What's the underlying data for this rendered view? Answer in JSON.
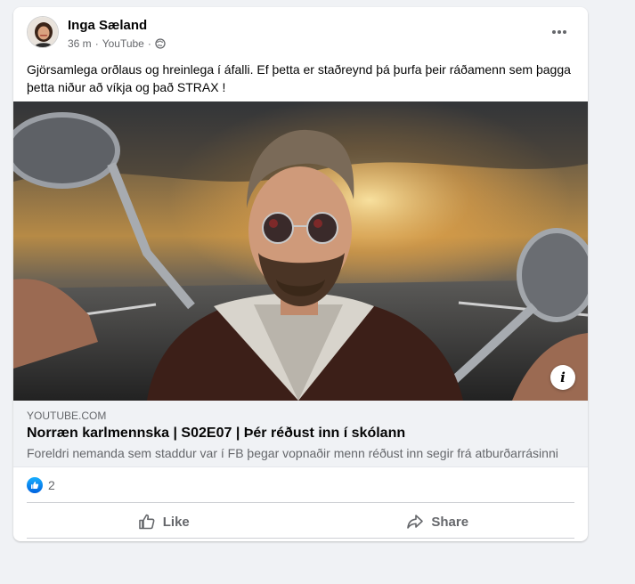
{
  "post": {
    "author": "Inga Sæland",
    "time": "36 m",
    "separator": "·",
    "source": "YouTube",
    "privacy_icon": "globe-icon",
    "more_icon": "more-horizontal-icon",
    "text": "Gjörsamlega orðlaus og hreinlega í áfalli. Ef þetta er staðreynd þá þurfa þeir ráðamenn sem þagga þetta niður að víkja og það STRAX !"
  },
  "link_preview": {
    "domain": "YOUTUBE.COM",
    "title": "Norræn karlmennska | S02E07 | Þér réðust inn í skólann",
    "description": "Foreldri nemanda sem staddur var í FB þegar vopnaðir menn réðust inn segir frá atburðarrásinni",
    "info_label": "i"
  },
  "reactions": {
    "icon": "like-reaction-icon",
    "count": "2"
  },
  "actions": {
    "like_label": "Like",
    "share_label": "Share"
  },
  "colors": {
    "accent_blue": "#1877f2",
    "secondary_text": "#65676b",
    "card_background": "#ffffff",
    "page_background": "#f0f2f5"
  }
}
